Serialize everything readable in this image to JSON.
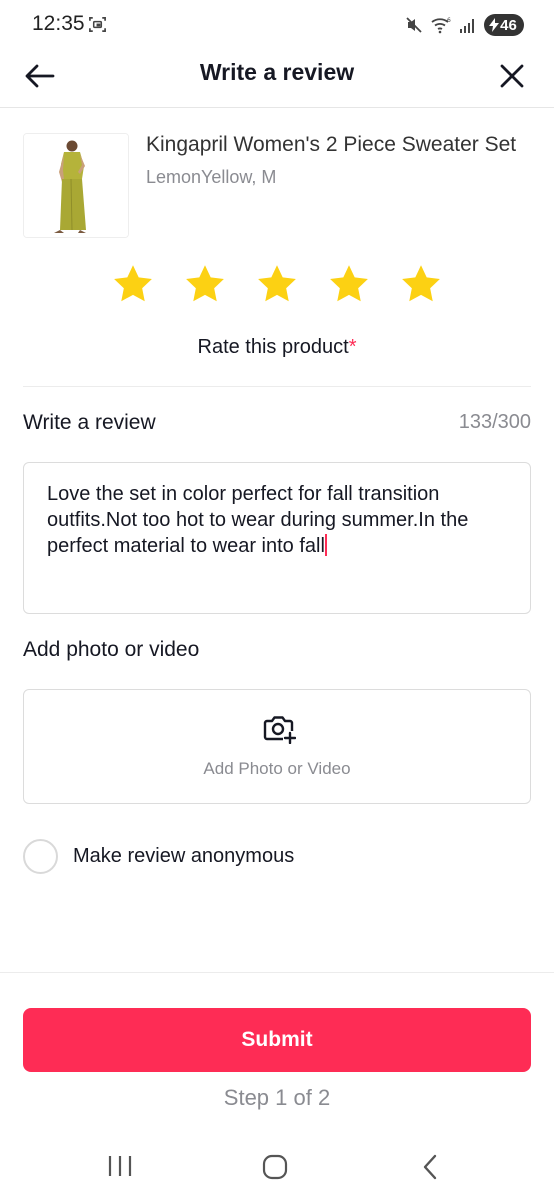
{
  "status_bar": {
    "time": "12:35",
    "battery": "46"
  },
  "header": {
    "title": "Write a review",
    "back_icon": "arrow-left-icon",
    "close_icon": "close-icon"
  },
  "product": {
    "name": "Kingapril Women's 2 Piece Sweater Set",
    "variant": "LemonYellow, M",
    "image_icon": "product-dress-image"
  },
  "rating": {
    "stars": 5,
    "max": 5,
    "label": "Rate this product",
    "required_mark": "*"
  },
  "review": {
    "label": "Write a review",
    "count": "133/300",
    "text": "Love the set in color perfect for fall transition outfits.Not too hot to wear during summer.In the perfect material to wear into fall"
  },
  "media": {
    "label": "Add photo or video",
    "button_text": "Add Photo or Video",
    "icon": "camera-add-icon"
  },
  "anonymous": {
    "label": "Make review anonymous",
    "checked": false
  },
  "submit": {
    "label": "Submit",
    "step": "Step 1 of 2"
  },
  "colors": {
    "accent": "#fe2c55",
    "star": "#fcd113",
    "muted_text": "#8a8b91",
    "primary_text": "#161823"
  }
}
